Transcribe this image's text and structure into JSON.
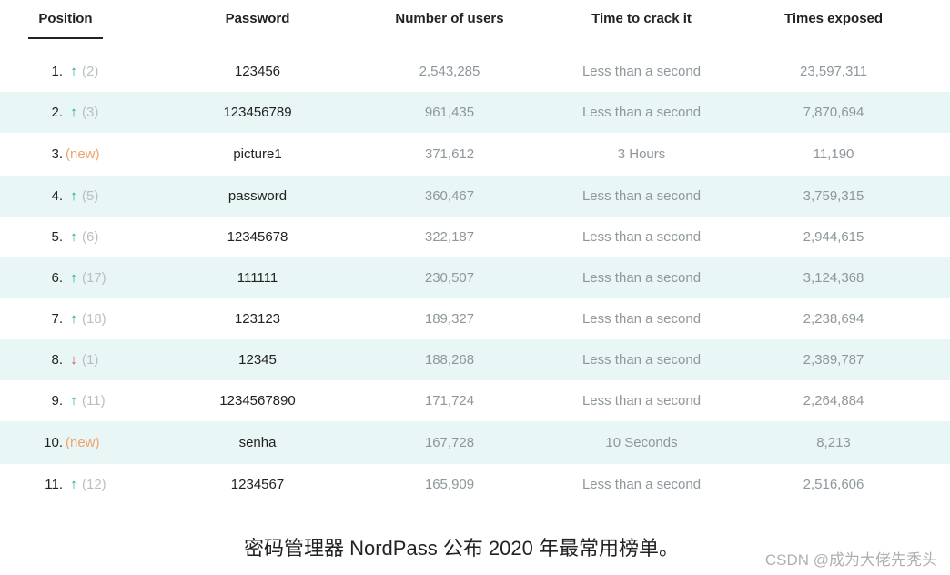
{
  "headers": {
    "position": "Position",
    "password": "Password",
    "users": "Number of users",
    "crack": "Time to crack it",
    "exposed": "Times exposed"
  },
  "rows": [
    {
      "pos": "1.",
      "trend": "up",
      "prev": "(2)",
      "password": "123456",
      "users": "2,543,285",
      "crack": "Less than a second",
      "exposed": "23,597,311"
    },
    {
      "pos": "2.",
      "trend": "up",
      "prev": "(3)",
      "password": "123456789",
      "users": "961,435",
      "crack": "Less than a second",
      "exposed": "7,870,694"
    },
    {
      "pos": "3.",
      "trend": "new",
      "prev": "(new)",
      "password": "picture1",
      "users": "371,612",
      "crack": "3 Hours",
      "exposed": "11,190"
    },
    {
      "pos": "4.",
      "trend": "up",
      "prev": "(5)",
      "password": "password",
      "users": "360,467",
      "crack": "Less than a second",
      "exposed": "3,759,315"
    },
    {
      "pos": "5.",
      "trend": "up",
      "prev": "(6)",
      "password": "12345678",
      "users": "322,187",
      "crack": "Less than a second",
      "exposed": "2,944,615"
    },
    {
      "pos": "6.",
      "trend": "up",
      "prev": "(17)",
      "password": "111111",
      "users": "230,507",
      "crack": "Less than a second",
      "exposed": "3,124,368"
    },
    {
      "pos": "7.",
      "trend": "up",
      "prev": "(18)",
      "password": "123123",
      "users": "189,327",
      "crack": "Less than a second",
      "exposed": "2,238,694"
    },
    {
      "pos": "8.",
      "trend": "down",
      "prev": "(1)",
      "password": "12345",
      "users": "188,268",
      "crack": "Less than a second",
      "exposed": "2,389,787"
    },
    {
      "pos": "9.",
      "trend": "up",
      "prev": "(11)",
      "password": "1234567890",
      "users": "171,724",
      "crack": "Less than a second",
      "exposed": "2,264,884"
    },
    {
      "pos": "10.",
      "trend": "new",
      "prev": "(new)",
      "password": "senha",
      "users": "167,728",
      "crack": "10 Seconds",
      "exposed": "8,213"
    },
    {
      "pos": "11.",
      "trend": "up",
      "prev": "(12)",
      "password": "1234567",
      "users": "165,909",
      "crack": "Less than a second",
      "exposed": "2,516,606"
    }
  ],
  "arrows": {
    "up": "↑",
    "down": "↓"
  },
  "caption": "密码管理器 NordPass 公布 2020 年最常用榜单。",
  "watermark": "CSDN @成为大佬先秃头",
  "colors": {
    "shaded_row": "#e9f6f6",
    "arrow_up": "#17a2a2",
    "arrow_down": "#e2445c",
    "new_tag": "#f0a368"
  }
}
